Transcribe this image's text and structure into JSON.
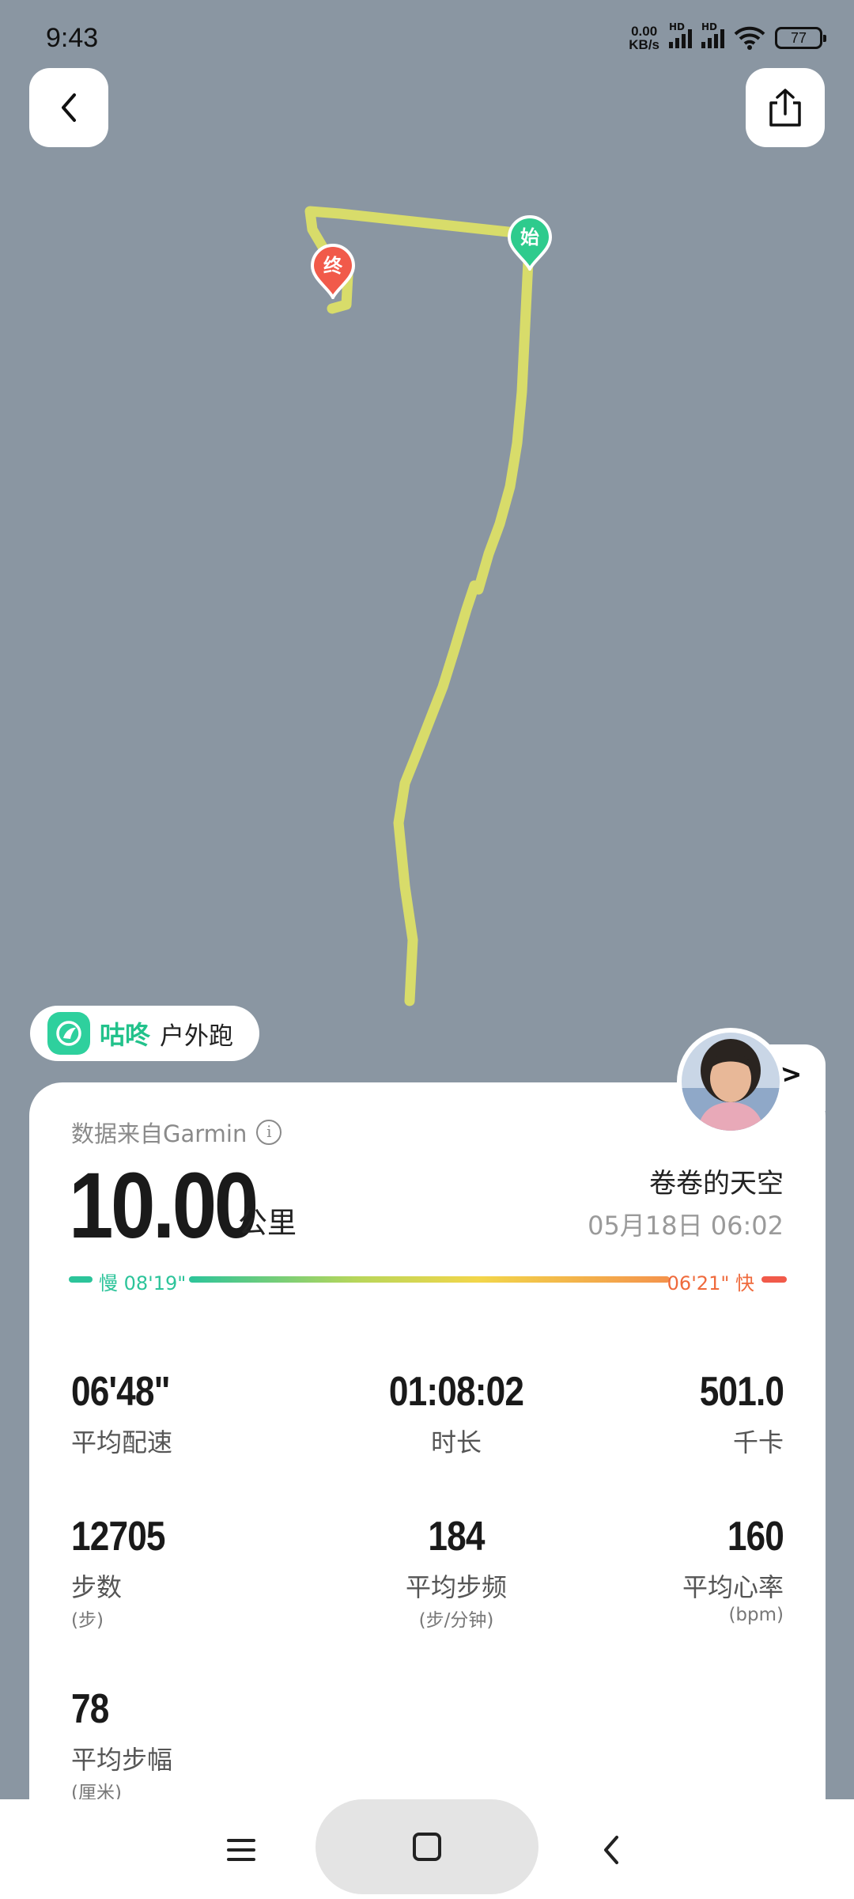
{
  "status_bar": {
    "time": "9:43",
    "net_speed_value": "0.00",
    "net_speed_unit": "KB/s",
    "signal_label": "HD",
    "battery": "77"
  },
  "map": {
    "start_label": "始",
    "end_label": "终",
    "route_color": "#d8dc6a",
    "start_color": "#2ecb8d",
    "end_color": "#f15a4a"
  },
  "brand": {
    "name": "咕咚",
    "activity": "户外跑"
  },
  "summary": {
    "source": "数据来自Garmin",
    "distance": "10.00",
    "distance_unit": "公里",
    "user_name": "卷卷的天空",
    "date": "05月18日 06:02",
    "pace_slow": "慢 08'19\"",
    "pace_fast": "06'21\" 快"
  },
  "stats": {
    "avg_pace": {
      "value": "06'48\"",
      "label": "平均配速"
    },
    "duration": {
      "value": "01:08:02",
      "label": "时长"
    },
    "calories": {
      "value": "501.0",
      "label": "千卡"
    },
    "steps": {
      "value": "12705",
      "label": "步数",
      "unit": "(步)"
    },
    "cadence": {
      "value": "184",
      "label": "平均步频",
      "unit": "(步/分钟)"
    },
    "heart_rate": {
      "value": "160",
      "label": "平均心率",
      "unit": "(bpm)"
    },
    "stride": {
      "value": "78",
      "label": "平均步幅",
      "unit": "(厘米)"
    }
  }
}
